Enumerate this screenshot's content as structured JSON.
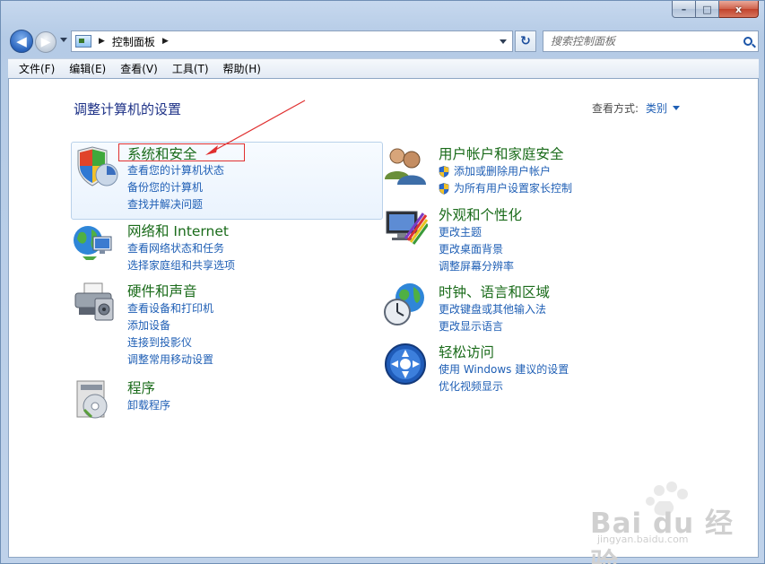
{
  "window": {
    "caption_buttons": {
      "minimize": "–",
      "maximize": "□",
      "close": "x"
    }
  },
  "nav": {
    "back_glyph": "◀",
    "forward_glyph": "▶",
    "breadcrumb_separator": "▶",
    "breadcrumb": "控制面板",
    "refresh_glyph": "↻",
    "search_placeholder": "搜索控制面板"
  },
  "menubar": {
    "items": [
      "文件(F)",
      "编辑(E)",
      "查看(V)",
      "工具(T)",
      "帮助(H)"
    ]
  },
  "content": {
    "heading": "调整计算机的设置",
    "view_by_label": "查看方式:",
    "view_by_value": "类别"
  },
  "categories": [
    {
      "title": "系统和安全",
      "icon": "shield-icon",
      "links": [
        {
          "text": "查看您的计算机状态",
          "shield": false
        },
        {
          "text": "备份您的计算机",
          "shield": false
        },
        {
          "text": "查找并解决问题",
          "shield": false
        }
      ]
    },
    {
      "title": "网络和 Internet",
      "icon": "network-globe-icon",
      "links": [
        {
          "text": "查看网络状态和任务",
          "shield": false
        },
        {
          "text": "选择家庭组和共享选项",
          "shield": false
        }
      ]
    },
    {
      "title": "硬件和声音",
      "icon": "printer-icon",
      "links": [
        {
          "text": "查看设备和打印机",
          "shield": false
        },
        {
          "text": "添加设备",
          "shield": false
        },
        {
          "text": "连接到投影仪",
          "shield": false
        },
        {
          "text": "调整常用移动设置",
          "shield": false
        }
      ]
    },
    {
      "title": "程序",
      "icon": "programs-icon",
      "links": [
        {
          "text": "卸载程序",
          "shield": false
        }
      ]
    },
    {
      "title": "用户帐户和家庭安全",
      "icon": "users-icon",
      "links": [
        {
          "text": "添加或删除用户帐户",
          "shield": true
        },
        {
          "text": "为所有用户设置家长控制",
          "shield": true
        }
      ]
    },
    {
      "title": "外观和个性化",
      "icon": "appearance-monitor-icon",
      "links": [
        {
          "text": "更改主题",
          "shield": false
        },
        {
          "text": "更改桌面背景",
          "shield": false
        },
        {
          "text": "调整屏幕分辨率",
          "shield": false
        }
      ]
    },
    {
      "title": "时钟、语言和区域",
      "icon": "clock-globe-icon",
      "links": [
        {
          "text": "更改键盘或其他输入法",
          "shield": false
        },
        {
          "text": "更改显示语言",
          "shield": false
        }
      ]
    },
    {
      "title": "轻松访问",
      "icon": "ease-of-access-icon",
      "links": [
        {
          "text": "使用 Windows 建议的设置",
          "shield": false
        },
        {
          "text": "优化视频显示",
          "shield": false
        }
      ]
    }
  ],
  "watermark": {
    "brand": "Bai du 经验",
    "url": "jingyan.baidu.com"
  },
  "colors": {
    "category_title": "#1a6b1a",
    "link": "#1f5fb5",
    "heading": "#1e3287",
    "annotation": "#e03030"
  }
}
